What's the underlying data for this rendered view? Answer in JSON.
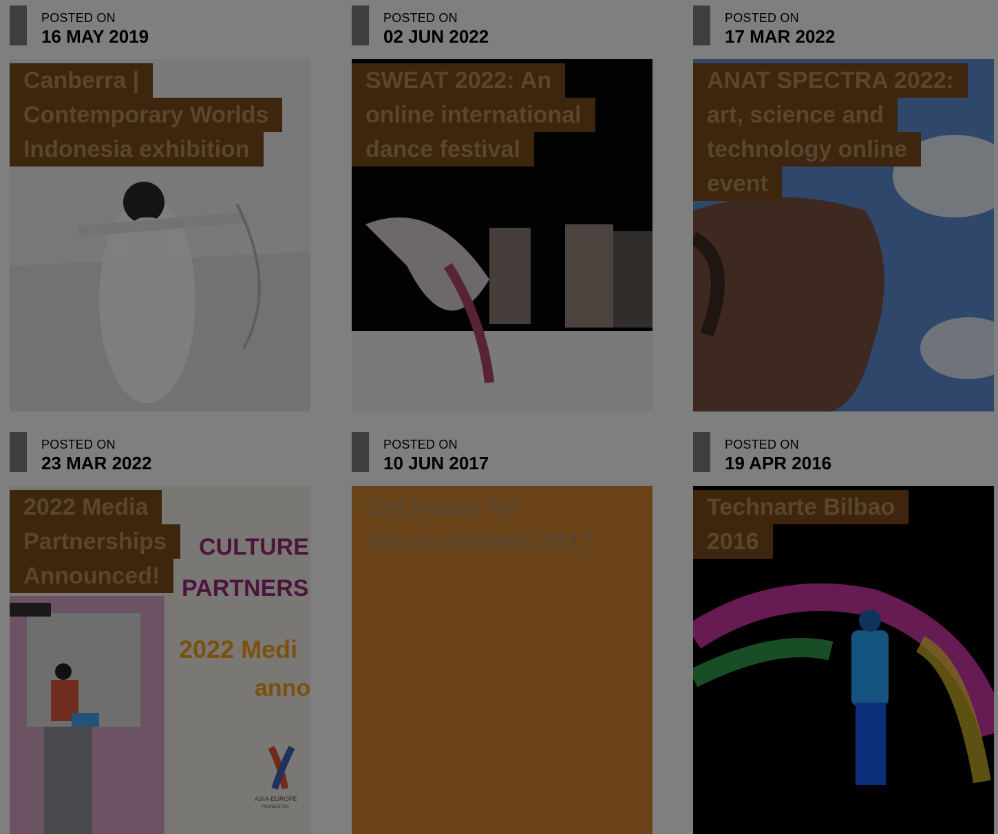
{
  "posted_label": "POSTED ON",
  "posts": [
    {
      "date": "16 MAY 2019",
      "title_lines": [
        "Canberra |",
        "Contemporary Worlds",
        "Indonesia exhibition"
      ],
      "image": "archer-figure-image"
    },
    {
      "date": "02 JUN 2022",
      "title_lines": [
        "SWEAT 2022: An",
        "online international",
        "dance festival"
      ],
      "image": "dance-motion-image"
    },
    {
      "date": "17 MAR 2022",
      "title_lines": [
        "ANAT SPECTRA 2022:",
        "art, science and",
        "technology online",
        "event"
      ],
      "image": "sky-portrait-image"
    },
    {
      "date": "23 MAR 2022",
      "title_lines": [
        "2022 Media",
        "Partnerships",
        "Announced!"
      ],
      "image": "media-partnerships-image",
      "image_text": {
        "line1": "CULTURE",
        "line2": "PARTNERS",
        "line3": "2022 Medi",
        "line4": "anno",
        "logo": "ASIA-EUROPE",
        "logo_sub": "FOUNDATION"
      }
    },
    {
      "date": "10 JUN 2017",
      "title_lines": [
        "Get Ready for",
        "#MuseumWeek 2017"
      ],
      "image": "none"
    },
    {
      "date": "19 APR 2016",
      "title_lines": [
        "Technarte Bilbao",
        "2016"
      ],
      "image": "projection-walker-image"
    }
  ],
  "colors": {
    "tag_bg": "#7a4a1c",
    "tag_text": "#b48b5e",
    "overlay": "rgba(0,0,0,0.5)",
    "plain_card": "#6b4019"
  }
}
